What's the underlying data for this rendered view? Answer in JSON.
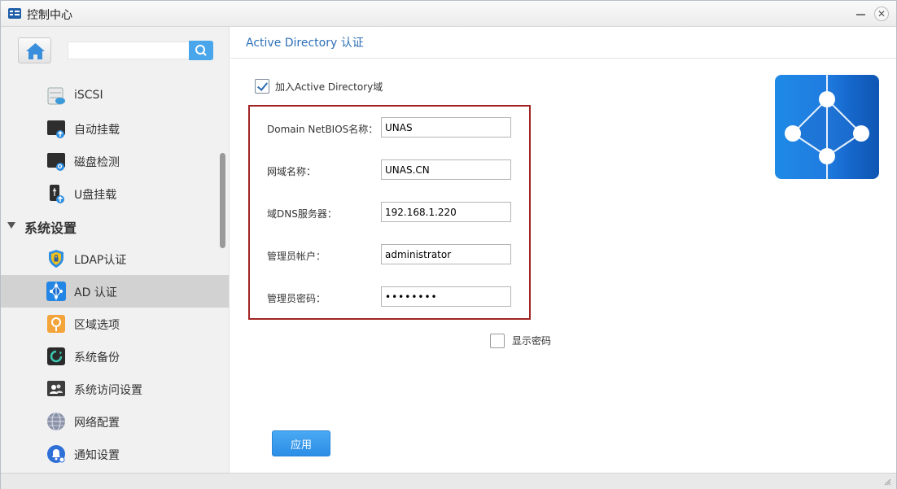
{
  "window": {
    "title": "控制中心"
  },
  "sidebar": {
    "search": {
      "value": "",
      "placeholder": ""
    },
    "items_top": [
      {
        "label": "iSCSI",
        "icon": "iscsi-storage-icon"
      },
      {
        "label": "自动挂载",
        "icon": "auto-mount-icon"
      },
      {
        "label": "磁盘检测",
        "icon": "disk-check-icon"
      },
      {
        "label": "U盘挂载",
        "icon": "usb-mount-icon"
      }
    ],
    "section": {
      "label": "系统设置",
      "expanded": true
    },
    "items_section": [
      {
        "label": "LDAP认证",
        "icon": "ldap-shield-icon"
      },
      {
        "label": "AD 认证",
        "icon": "active-directory-icon",
        "active": true
      },
      {
        "label": "区域选项",
        "icon": "region-icon"
      },
      {
        "label": "系统备份",
        "icon": "backup-icon"
      },
      {
        "label": "系统访问设置",
        "icon": "access-settings-icon"
      },
      {
        "label": "网络配置",
        "icon": "network-globe-icon"
      },
      {
        "label": "通知设置",
        "icon": "notification-bell-icon"
      }
    ]
  },
  "main": {
    "title": "Active Directory 认证",
    "join": {
      "label": "加入Active Directory域",
      "checked": true
    },
    "fields": {
      "netbios": {
        "label": "Domain NetBIOS名称：",
        "value": "UNAS"
      },
      "domain": {
        "label": "网域名称：",
        "value": "UNAS.CN"
      },
      "dns": {
        "label": "域DNS服务器：",
        "value": "192.168.1.220"
      },
      "admin_user": {
        "label": "管理员帐户：",
        "value": "administrator"
      },
      "admin_password": {
        "label": "管理员密码：",
        "value": "••••••••"
      }
    },
    "show_password": {
      "label": "显示密码",
      "checked": false
    },
    "apply_label": "应用"
  },
  "colors": {
    "accent": "#2c8ee6",
    "title_blue": "#2d6fb7",
    "highlight_box": "#a12424",
    "sidebar_active": "#d2d2d2"
  }
}
